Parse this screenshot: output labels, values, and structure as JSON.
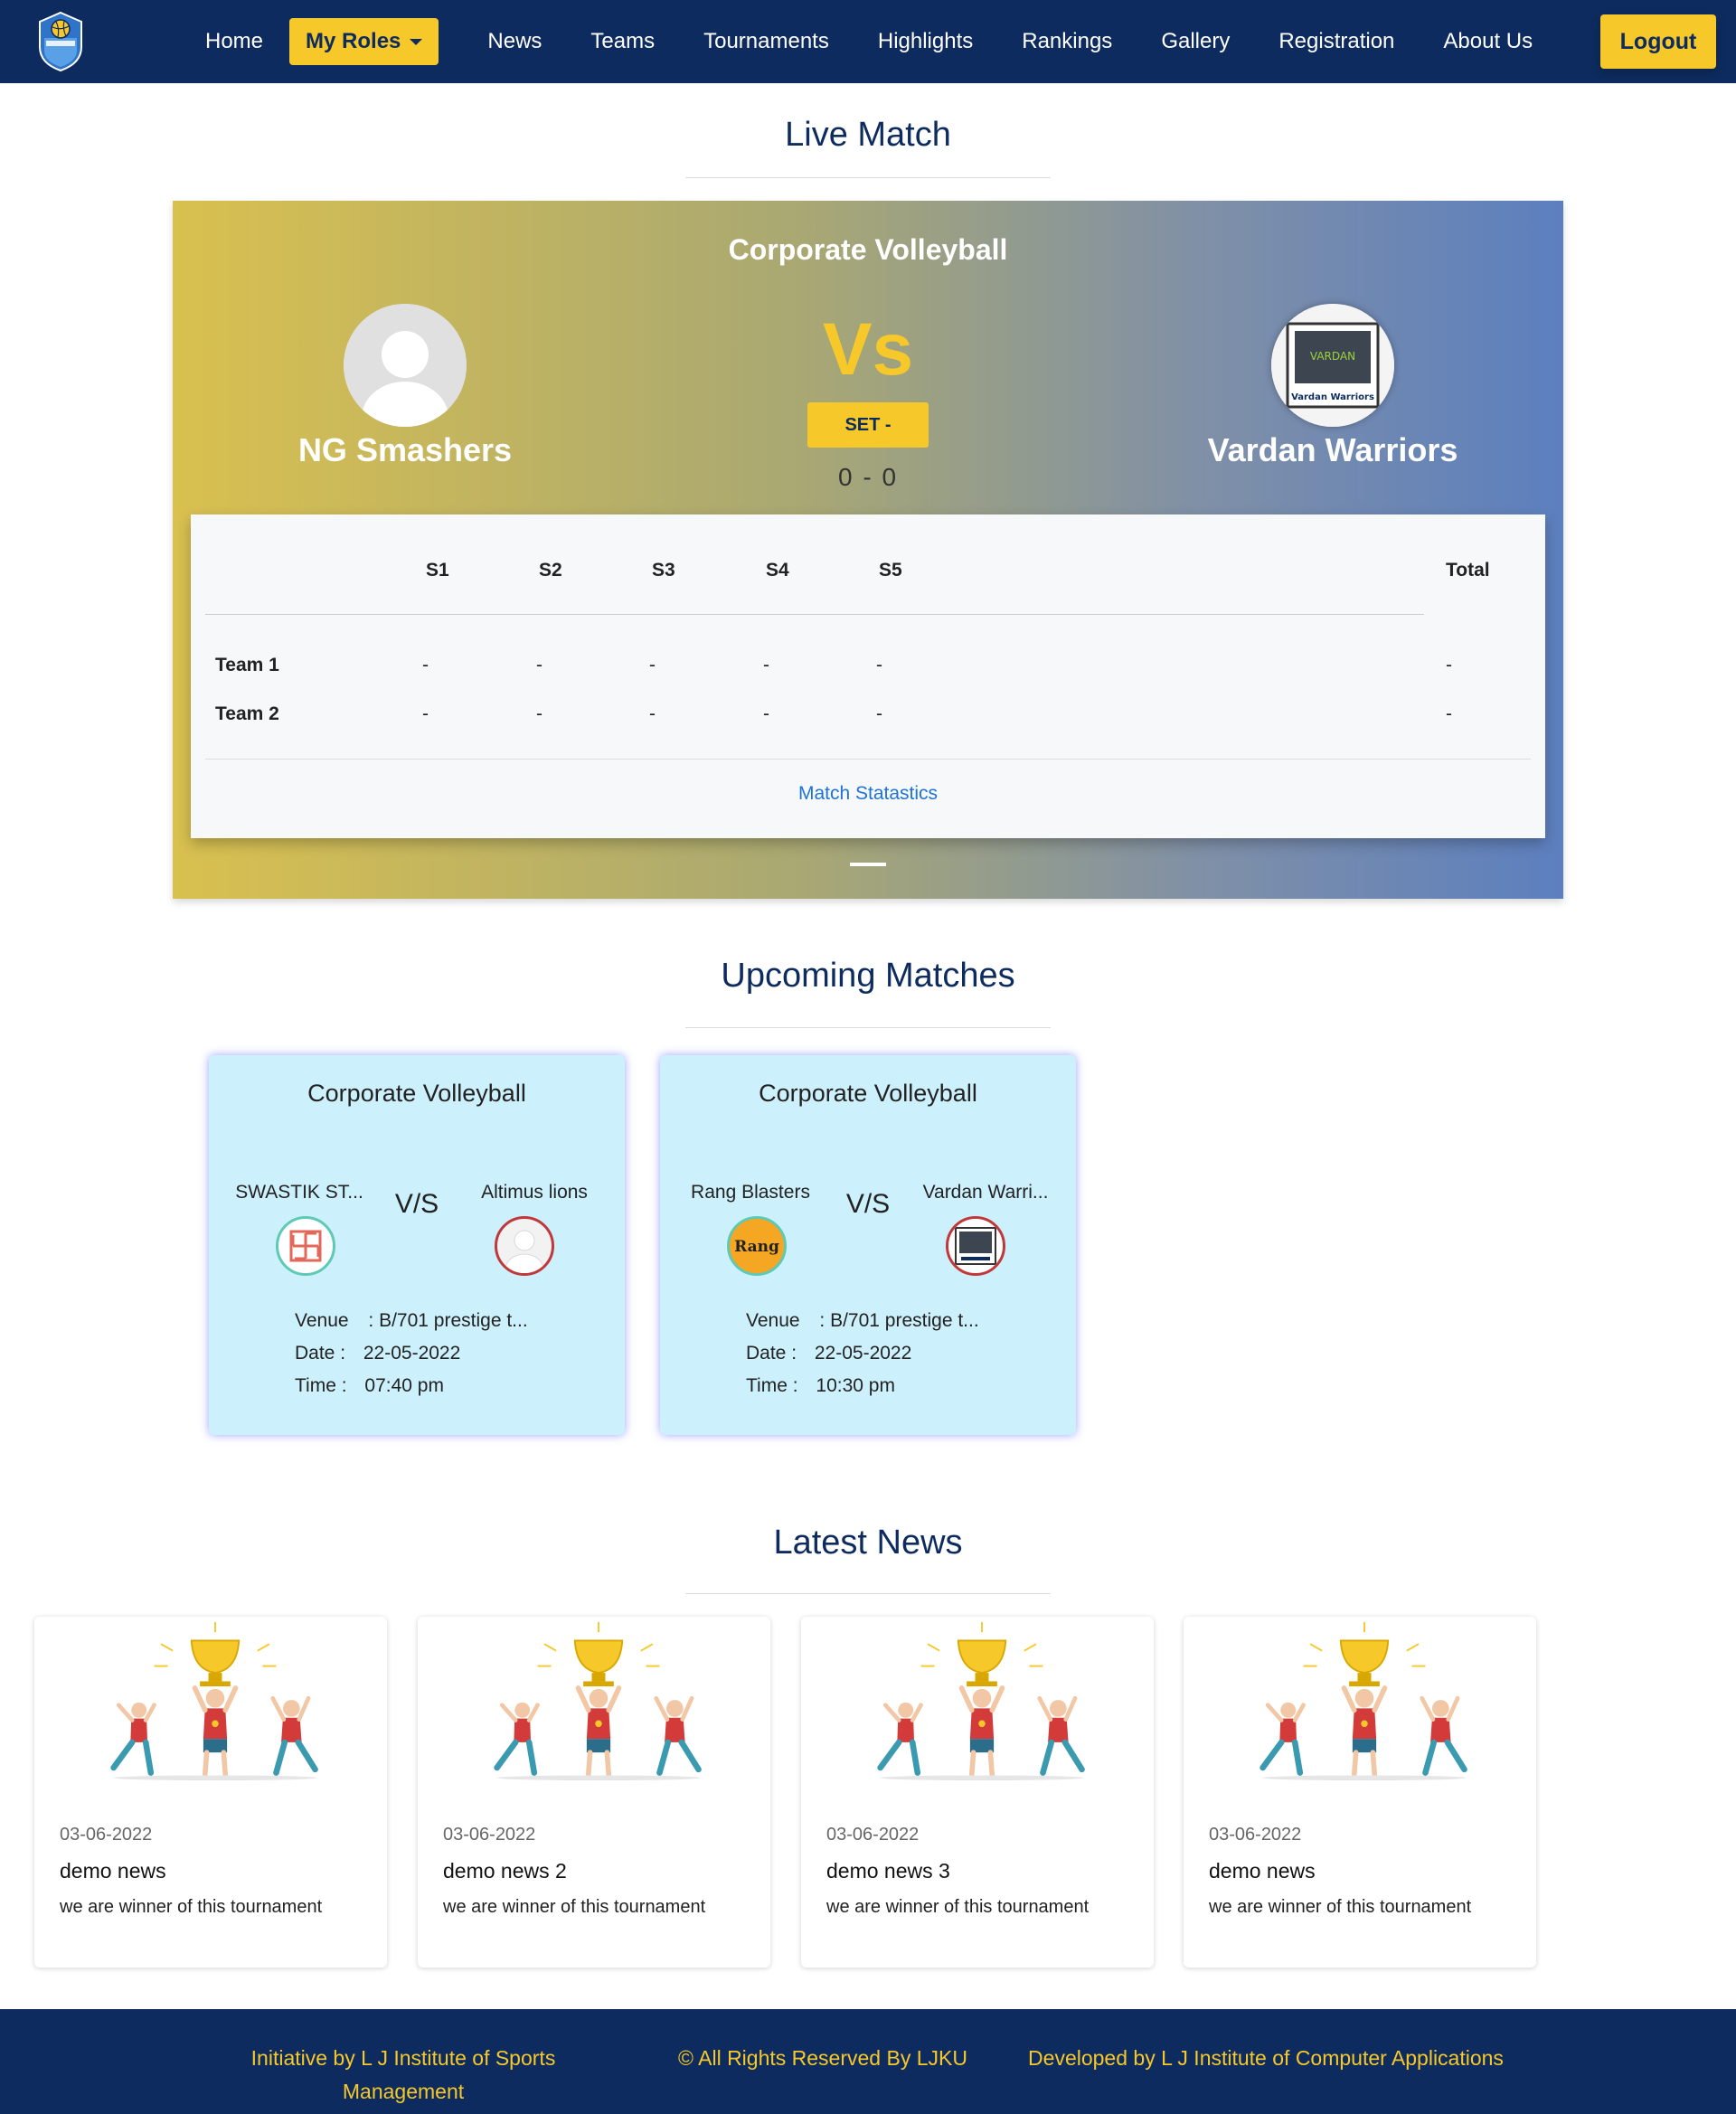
{
  "nav": {
    "items": [
      "Home",
      "My Roles",
      "News",
      "Teams",
      "Tournaments",
      "Highlights",
      "Rankings",
      "Gallery",
      "Registration",
      "About Us"
    ],
    "logout": "Logout",
    "logo_icon": "volleyball-shield-logo",
    "accent_color": "#f6c829",
    "bg_color": "#0d2b5e"
  },
  "live": {
    "section_title": "Live Match",
    "tournament": "Corporate Volleyball",
    "team_left": "NG Smashers",
    "team_right": "Vardan Warriors",
    "vs": "Vs",
    "set_label": "SET -",
    "score": "0 - 0",
    "table": {
      "headers": [
        "S1",
        "S2",
        "S3",
        "S4",
        "S5"
      ],
      "total_header": "Total",
      "rows": [
        {
          "team": "Team 1",
          "sets": [
            "-",
            "-",
            "-",
            "-",
            "-"
          ],
          "total": "-"
        },
        {
          "team": "Team 2",
          "sets": [
            "-",
            "-",
            "-",
            "-",
            "-"
          ],
          "total": "-"
        }
      ]
    },
    "stats_link": "Match Statastics"
  },
  "upcoming": {
    "section_title": "Upcoming Matches",
    "vs": "V/S",
    "venue_label": "Venue",
    "date_label": "Date :",
    "time_label": "Time :",
    "matches": [
      {
        "tournament": "Corporate Volleyball",
        "team1": "SWASTIK ST...",
        "team2": "Altimus lions",
        "venue": ": B/701 prestige t...",
        "date": "22-05-2022",
        "time": "07:40 pm"
      },
      {
        "tournament": "Corporate Volleyball",
        "team1": "Rang Blasters",
        "team2": "Vardan Warri...",
        "venue": ": B/701 prestige t...",
        "date": "22-05-2022",
        "time": "10:30 pm"
      }
    ]
  },
  "news": {
    "section_title": "Latest News",
    "items": [
      {
        "date": "03-06-2022",
        "title": "demo news",
        "desc": "we are winner of this tournament"
      },
      {
        "date": "03-06-2022",
        "title": "demo news 2",
        "desc": "we are winner of this tournament"
      },
      {
        "date": "03-06-2022",
        "title": "demo news 3",
        "desc": "we are winner of this tournament"
      },
      {
        "date": "03-06-2022",
        "title": "demo news",
        "desc": "we are winner of this tournament"
      }
    ]
  },
  "footer": {
    "left": "Initiative by L J Institute of Sports Management",
    "center": "© All Rights Reserved By LJKU",
    "right": "Developed by L J Institute of Computer Applications"
  }
}
